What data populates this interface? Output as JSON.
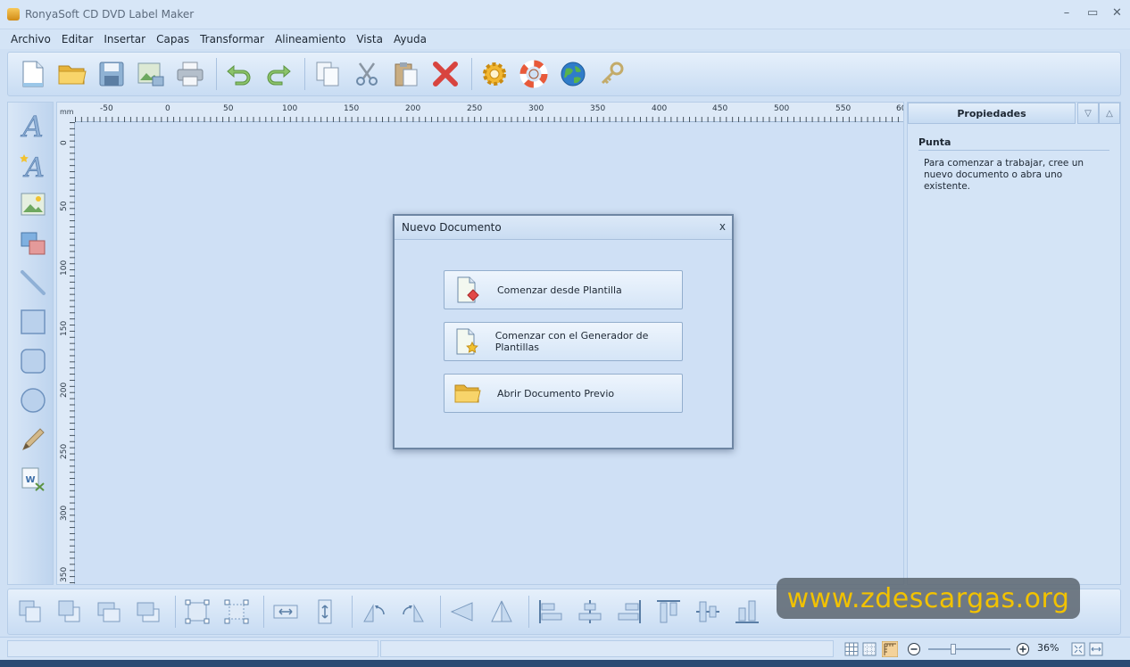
{
  "window": {
    "title": "RonyaSoft CD DVD Label Maker",
    "minimize": "–",
    "maximize": "▭",
    "close": "✕"
  },
  "menu": [
    "Archivo",
    "Editar",
    "Insertar",
    "Capas",
    "Transformar",
    "Alineamiento",
    "Vista",
    "Ayuda"
  ],
  "ruler": {
    "unit": "mm",
    "top_labels": [
      "-50",
      "0",
      "50",
      "100",
      "150",
      "200",
      "250",
      "300",
      "350",
      "400",
      "450",
      "500",
      "550",
      "60"
    ],
    "left_labels": [
      "0",
      "50",
      "100",
      "150",
      "200",
      "250",
      "300",
      "350"
    ]
  },
  "dialog": {
    "title": "Nuevo Documento",
    "close": "x",
    "buttons": [
      "Comenzar desde Plantilla",
      "Comenzar con el Generador de Plantillas",
      "Abrir Documento Previo"
    ]
  },
  "properties": {
    "header": "Propiedades",
    "section": "Punta",
    "text": "Para comenzar a trabajar, cree un nuevo documento o abra uno existente."
  },
  "status": {
    "zoom": "36%"
  },
  "watermark": "www.zdescargas.org",
  "icons": {
    "toolbar": [
      "new-document-icon",
      "open-folder-icon",
      "save-icon",
      "export-image-icon",
      "print-icon",
      "undo-icon",
      "redo-icon",
      "copy-icon",
      "cut-icon",
      "paste-icon",
      "delete-icon",
      "settings-gear-icon",
      "help-lifebuoy-icon",
      "web-globe-icon",
      "key-icon"
    ],
    "tools": [
      "text-tool-icon",
      "art-text-tool-icon",
      "image-tool-icon",
      "clipart-tool-icon",
      "line-tool-icon",
      "rectangle-tool-icon",
      "rounded-rectangle-tool-icon",
      "ellipse-tool-icon",
      "pencil-tool-icon",
      "word-import-tool-icon"
    ]
  }
}
